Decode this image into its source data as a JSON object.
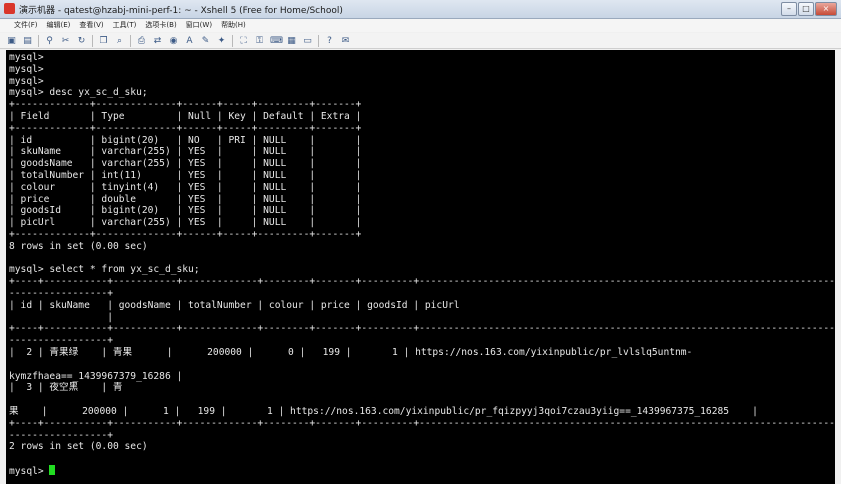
{
  "window": {
    "title": "演示机器 - qatest@hzabj-mini-perf-1: ~ - Xshell 5 (Free for Home/School)",
    "controls": {
      "minimize": "–",
      "maximize": "□",
      "close": "×"
    }
  },
  "menu": [
    "文件(F)",
    "编辑(E)",
    "查看(V)",
    "工具(T)",
    "选项卡(B)",
    "窗口(W)",
    "帮助(H)"
  ],
  "toolbar": [
    {
      "icon": "new-session-icon",
      "glyph": "▣"
    },
    {
      "icon": "open-folder-icon",
      "glyph": "▤"
    },
    {
      "icon": "connect-icon",
      "glyph": "⚲"
    },
    {
      "icon": "disconnect-icon",
      "glyph": "✂"
    },
    {
      "icon": "reconnect-icon",
      "glyph": "↻"
    },
    {
      "icon": "copy-icon",
      "glyph": "❐"
    },
    {
      "icon": "find-icon",
      "glyph": "⌕"
    },
    {
      "icon": "print-icon",
      "glyph": "⎙"
    },
    {
      "icon": "transfer-icon",
      "glyph": "⇄"
    },
    {
      "icon": "globe-icon",
      "glyph": "◉"
    },
    {
      "icon": "font-icon",
      "glyph": "A"
    },
    {
      "icon": "compose-icon",
      "glyph": "✎"
    },
    {
      "icon": "script-icon",
      "glyph": "✦"
    },
    {
      "icon": "fullscreen-icon",
      "glyph": "⛶"
    },
    {
      "icon": "lock-icon",
      "glyph": "⚿"
    },
    {
      "icon": "keyboard-icon",
      "glyph": "⌨"
    },
    {
      "icon": "layout-icon",
      "glyph": "▦"
    },
    {
      "icon": "transparency-icon",
      "glyph": "▭"
    },
    {
      "icon": "help-icon",
      "glyph": "?"
    },
    {
      "icon": "chat-icon",
      "glyph": "✉"
    }
  ],
  "terminal": {
    "lines": [
      "mysql>",
      "mysql>",
      "mysql>",
      "mysql> desc yx_sc_d_sku;",
      "+-------------+--------------+------+-----+---------+-------+",
      "| Field       | Type         | Null | Key | Default | Extra |",
      "+-------------+--------------+------+-----+---------+-------+",
      "| id          | bigint(20)   | NO   | PRI | NULL    |       |",
      "| skuName     | varchar(255) | YES  |     | NULL    |       |",
      "| goodsName   | varchar(255) | YES  |     | NULL    |       |",
      "| totalNumber | int(11)      | YES  |     | NULL    |       |",
      "| colour      | tinyint(4)   | YES  |     | NULL    |       |",
      "| price       | double       | YES  |     | NULL    |       |",
      "| goodsId     | bigint(20)   | YES  |     | NULL    |       |",
      "| picUrl      | varchar(255) | YES  |     | NULL    |       |",
      "+-------------+--------------+------+-----+---------+-------+",
      "8 rows in set (0.00 sec)",
      "",
      "mysql> select * from yx_sc_d_sku;",
      "+----+-----------+-----------+-------------+--------+-------+---------+--------------------------------------------------------------------------------",
      "-----------------+",
      "| id | skuName   | goodsName | totalNumber | colour | price | goodsId | picUrl",
      "                 |",
      "+----+-----------+-----------+-------------+--------+-------+---------+--------------------------------------------------------------------------------",
      "-----------------+",
      "|  2 | 青果绿    | 青果      |      200000 |      0 |   199 |       1 | https://nos.163.com/yixinpublic/pr_lvlslq5untnm-",
      "",
      "kymzfhaea==_1439967379_16286 |",
      "|  3 | 夜空黑    | 青",
      "",
      "果    |      200000 |      1 |   199 |       1 | https://nos.163.com/yixinpublic/pr_fqizpyyj3qoi7czau3yiig==_1439967375_16285    |",
      "+----+-----------+-----------+-------------+--------+-------+---------+--------------------------------------------------------------------------------",
      "-----------------+",
      "2 rows in set (0.00 sec)",
      "",
      "mysql> "
    ],
    "cursor_color": "#22dd22"
  }
}
